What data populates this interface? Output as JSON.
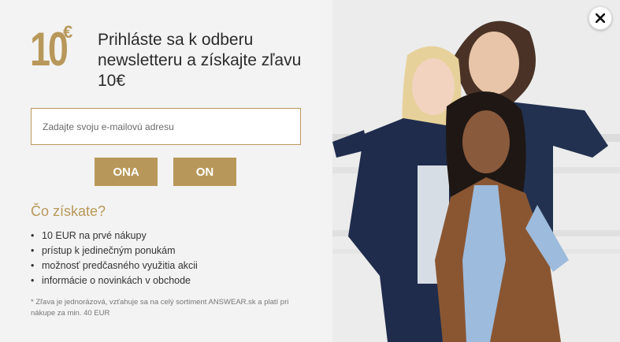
{
  "badge": {
    "value": "10",
    "currency": "€"
  },
  "headline": "Prihláste sa k odberu newsletteru a získajte zľavu 10€",
  "email": {
    "placeholder": "Zadajte svoju e-mailovú adresu",
    "value": ""
  },
  "buttons": {
    "ona": "ONA",
    "on": "ON"
  },
  "benefits": {
    "title": "Čo získate?",
    "items": [
      "10 EUR na prvé nákupy",
      "prístup k jedinečným ponukám",
      "možnosť predčasného využitia akcii",
      "informácie o novinkách v obchode"
    ]
  },
  "note": "* Zľava je jednorázová, vzťahuje sa na celý sortiment ANSWEAR.sk a platí pri nákupe za min. 40 EUR",
  "colors": {
    "accent": "#b8985a",
    "text": "#2b2b2b",
    "background": "#f3f3f3"
  },
  "icons": {
    "close": "close-icon"
  }
}
